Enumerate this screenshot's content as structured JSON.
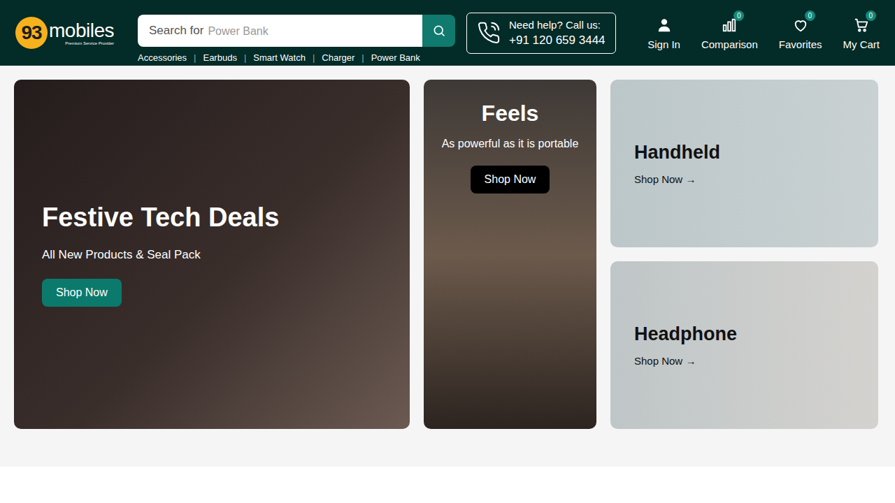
{
  "header": {
    "logo": {
      "number": "93",
      "word": "mobiles",
      "tagline": "Premium Service Provider"
    },
    "search": {
      "label": "Search for",
      "placeholder": "Power Bank"
    },
    "quick_links": [
      "Accessories",
      "Earbuds",
      "Smart Watch",
      "Charger",
      "Power Bank"
    ],
    "separator": "|",
    "help": {
      "title": "Need help? Call us:",
      "phone": "+91 120 659 3444"
    },
    "actions": [
      {
        "label": "Sign In",
        "kind": "account"
      },
      {
        "label": "Comparison",
        "kind": "compare",
        "badge": "0"
      },
      {
        "label": "Favorites",
        "kind": "favorites",
        "badge": "0"
      },
      {
        "label": "My Cart",
        "kind": "cart",
        "badge": "0"
      }
    ]
  },
  "banners": {
    "main": {
      "title": "Festive Tech Deals",
      "subtitle": "All New Products & Seal Pack",
      "button": "Shop Now"
    },
    "feature": {
      "title": "Feels",
      "subtitle": "As powerful as it is portable",
      "button": "Shop Now"
    },
    "side": [
      {
        "title": "Handheld",
        "link": "Shop Now",
        "arrow": "→"
      },
      {
        "title": "Headphone",
        "link": "Shop Now",
        "arrow": "→"
      }
    ]
  }
}
